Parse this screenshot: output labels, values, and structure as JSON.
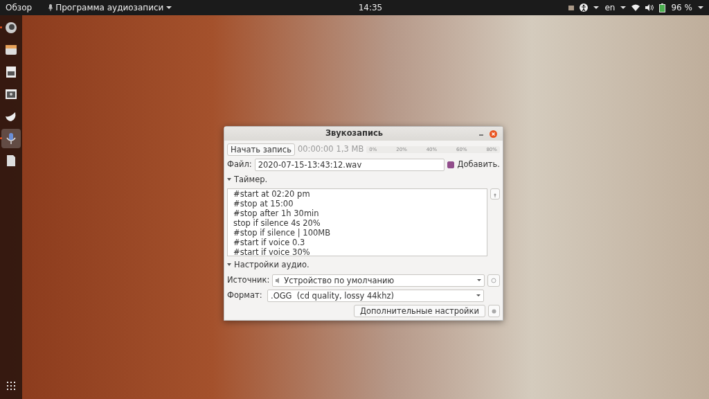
{
  "top_bar": {
    "activities": "Обзор",
    "app_menu": "Программа аудиозаписи",
    "clock": "14:35",
    "language": "en",
    "battery": "96 %"
  },
  "dock": [
    {
      "kind": "browser",
      "running": true,
      "selected": false
    },
    {
      "kind": "files",
      "running": false,
      "selected": false
    },
    {
      "kind": "document",
      "running": false,
      "selected": false
    },
    {
      "kind": "settings",
      "running": false,
      "selected": false
    },
    {
      "kind": "shell",
      "running": false,
      "selected": false
    },
    {
      "kind": "mic",
      "running": true,
      "selected": true
    },
    {
      "kind": "sheet",
      "running": false,
      "selected": false
    }
  ],
  "window": {
    "title": "Звукозапись",
    "record_button": "Начать запись",
    "time": "00:00:00",
    "size": "1,3 MB",
    "meter_ticks": [
      "0%",
      "20%",
      "40%",
      "60%",
      "80%"
    ],
    "meter": {
      "level": 0
    },
    "file_label": "Файл:",
    "file_value": "2020-07-15-13:43:12.wav",
    "append": {
      "label": "Добавить.",
      "checked": true
    },
    "timer": {
      "label": "Таймер.",
      "expanded": true,
      "lines": [
        "#start at 02:20 pm",
        "#stop at 15:00",
        "#stop after 1h 30min",
        "stop if silence 4s 20%",
        "#stop if silence | 100MB",
        "#start if voice 0.3",
        "#start if voice 30%"
      ]
    },
    "audio": {
      "label": "Настройки аудио.",
      "expanded": true,
      "source_label": "Источник:",
      "source_value": "Устройство по умолчанию",
      "format_label": "Формат:",
      "format_value": ".OGG  (cd quality, lossy 44khz)",
      "more_button": "Дополнительные настройки"
    }
  }
}
